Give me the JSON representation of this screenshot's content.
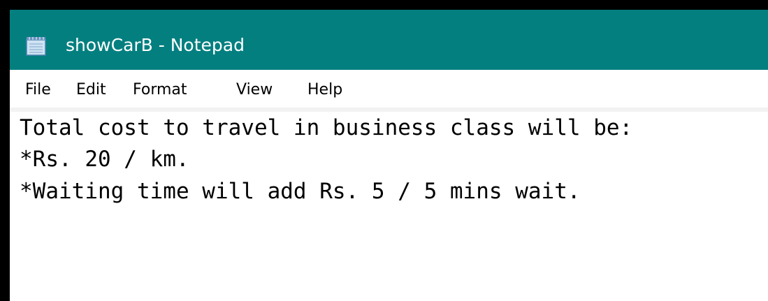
{
  "window": {
    "title": "showCarB - Notepad",
    "titlebar_color": "#047f80",
    "icon": "notepad-icon"
  },
  "menu": {
    "items": [
      "File",
      "Edit",
      "Format",
      "View",
      "Help"
    ]
  },
  "editor": {
    "lines": [
      "Total cost to travel in business class will be:",
      "*Rs. 20 / km.",
      "*Waiting time will add Rs. 5 / 5 mins wait."
    ]
  }
}
